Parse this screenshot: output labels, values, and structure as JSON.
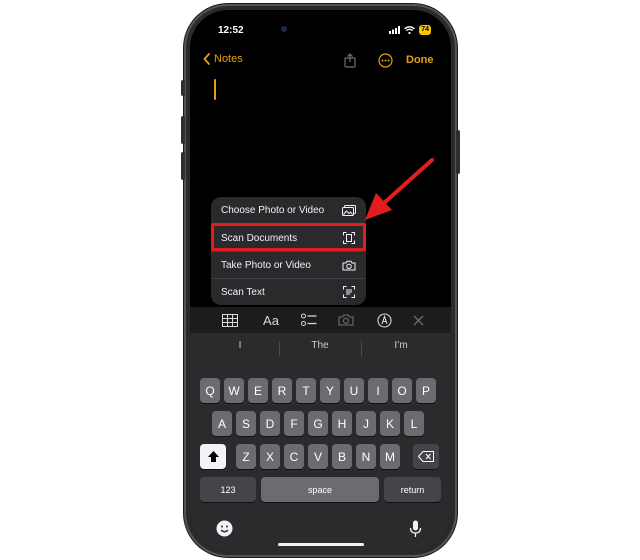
{
  "status_bar": {
    "time": "12:52",
    "battery": "74",
    "icons": [
      "signal-icon",
      "wifi-icon",
      "battery-icon"
    ]
  },
  "nav": {
    "back_label": "Notes",
    "done_label": "Done",
    "icons": [
      "chevron-left-icon",
      "share-icon",
      "more-icon"
    ],
    "accent_color": "#e5a00d"
  },
  "attach_menu": {
    "items": [
      {
        "label": "Choose Photo or Video",
        "icon": "photo-library-icon"
      },
      {
        "label": "Scan Documents",
        "icon": "scan-document-icon",
        "highlighted": true
      },
      {
        "label": "Take Photo or Video",
        "icon": "camera-icon"
      },
      {
        "label": "Scan Text",
        "icon": "scan-text-icon"
      }
    ],
    "highlight_color": "#e31d1d"
  },
  "toolbar": {
    "tools": [
      "table-icon",
      "text-format-icon",
      "checklist-icon",
      "camera-icon",
      "markup-icon",
      "close-icon"
    ],
    "format_label": "Aa"
  },
  "keyboard": {
    "predictions": [
      "I",
      "The",
      "I’m"
    ],
    "row1": [
      "Q",
      "W",
      "E",
      "R",
      "T",
      "Y",
      "U",
      "I",
      "O",
      "P"
    ],
    "row2": [
      "A",
      "S",
      "D",
      "F",
      "G",
      "H",
      "J",
      "K",
      "L"
    ],
    "row3": [
      "Z",
      "X",
      "C",
      "V",
      "B",
      "N",
      "M"
    ],
    "numbers_label": "123",
    "space_label": "space",
    "return_label": "return"
  },
  "annotation": {
    "arrow_color": "#e31d1d"
  }
}
